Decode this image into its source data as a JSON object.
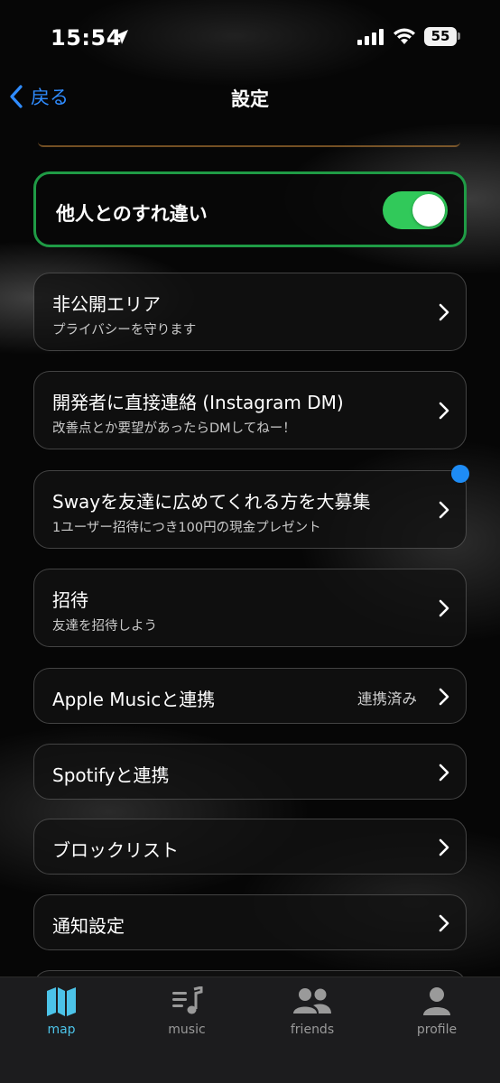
{
  "status_bar": {
    "time": "15:54",
    "battery": "55"
  },
  "nav": {
    "back_label": "戻る",
    "title": "設定"
  },
  "toggle_row": {
    "label": "他人とのすれ違い",
    "enabled": true
  },
  "rows": [
    {
      "title": "非公開エリア",
      "subtitle": "プライバシーを守ります"
    },
    {
      "title": "開発者に直接連絡 (Instagram DM)",
      "subtitle": "改善点とか要望があったらDMしてねー！"
    },
    {
      "title": "Swayを友達に広めてくれる方を大募集",
      "subtitle": "1ユーザー招待につき100円の現金プレゼント"
    },
    {
      "title": "招待",
      "subtitle": "友達を招待しよう"
    },
    {
      "title": "Apple Musicと連携",
      "value": "連携済み"
    },
    {
      "title": "Spotifyと連携"
    },
    {
      "title": "ブロックリスト"
    },
    {
      "title": "通知設定"
    }
  ],
  "tabs": [
    {
      "label": "map",
      "icon": "map-icon",
      "active": true
    },
    {
      "label": "music",
      "icon": "music-list-icon",
      "active": false
    },
    {
      "label": "friends",
      "icon": "friends-icon",
      "active": false
    },
    {
      "label": "profile",
      "icon": "profile-icon",
      "active": false
    }
  ],
  "colors": {
    "accent_blue": "#2f8cff",
    "toggle_green": "#31c95a",
    "active_tab": "#4cc3e8",
    "badge_blue": "#1e8cf5"
  }
}
